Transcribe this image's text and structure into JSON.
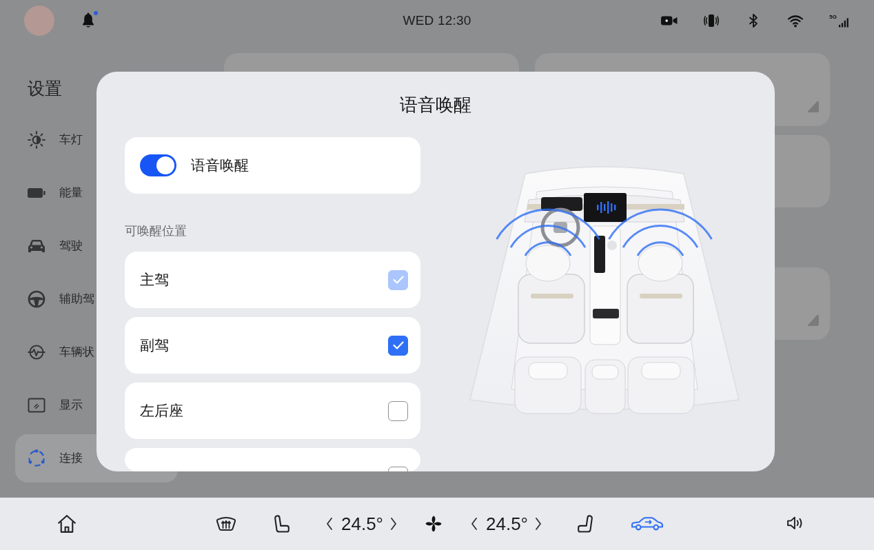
{
  "status_bar": {
    "notification_dot": true,
    "time": "WED 12:30",
    "network": "5G"
  },
  "sidebar": {
    "title": "设置",
    "items": [
      {
        "label": "车灯",
        "selected": false
      },
      {
        "label": "能量",
        "selected": false
      },
      {
        "label": "驾驶",
        "selected": false
      },
      {
        "label": "辅助驾",
        "selected": false
      },
      {
        "label": "车辆状",
        "selected": false
      },
      {
        "label": "显示",
        "selected": false
      },
      {
        "label": "连接",
        "selected": true
      }
    ]
  },
  "dialog": {
    "title": "语音唤醒",
    "toggle": {
      "label": "语音唤醒",
      "on": true
    },
    "section_label": "可唤醒位置",
    "positions": [
      {
        "label": "主驾",
        "checked": true,
        "disabled": true
      },
      {
        "label": "副驾",
        "checked": true,
        "disabled": false
      },
      {
        "label": "左后座",
        "checked": false,
        "disabled": false
      },
      {
        "checked": false,
        "disabled": false
      }
    ]
  },
  "bottom_bar": {
    "left_temperature": "24.5°",
    "right_temperature": "24.5°",
    "vehicle_icon_active": true
  }
}
